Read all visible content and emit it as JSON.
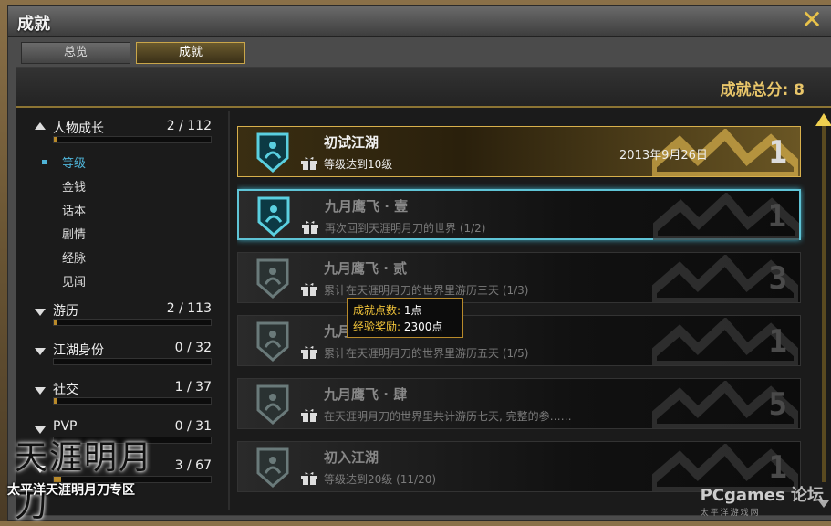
{
  "window": {
    "title": "成就",
    "close_icon": "close-icon"
  },
  "tabs": [
    {
      "label": "总览"
    },
    {
      "label": "成就",
      "active": true
    }
  ],
  "summary": {
    "label": "成就总分: 8"
  },
  "categories": [
    {
      "name": "人物成长",
      "count": "2 / 112",
      "expanded": true,
      "progress": 0.018,
      "children": [
        {
          "label": "等级",
          "active": true
        },
        {
          "label": "金钱"
        },
        {
          "label": "话本"
        },
        {
          "label": "剧情"
        },
        {
          "label": "经脉"
        },
        {
          "label": "见闻"
        }
      ]
    },
    {
      "name": "游历",
      "count": "2 / 113",
      "progress": 0.018
    },
    {
      "name": "江湖身份",
      "count": "0 / 32",
      "progress": 0
    },
    {
      "name": "社交",
      "count": "1 / 37",
      "progress": 0.027
    },
    {
      "name": "PVP",
      "count": "0 / 31",
      "progress": 0
    },
    {
      "name": "",
      "count": "3 / 67",
      "progress": 0.045
    }
  ],
  "achievements": [
    {
      "name": "初试江湖",
      "desc": "等级达到10级",
      "date": "2013年9月26日",
      "points": "1",
      "completed": true
    },
    {
      "name": "九月鹰飞 · 壹",
      "desc": "再次回到天涯明月刀的世界 (1/2)",
      "date": "",
      "points": "1",
      "highlighted": true
    },
    {
      "name": "九月鹰飞 · 贰",
      "desc": "累计在天涯明月刀的世界里游历三天 (1/3)",
      "date": "",
      "points": "3"
    },
    {
      "name": "九月鹰飞 · 叁",
      "desc": "累计在天涯明月刀的世界里游历五天 (1/5)",
      "date": "",
      "points": "1"
    },
    {
      "name": "九月鹰飞 · 肆",
      "desc": "在天涯明月刀的世界里共计游历七天, 完整的参……",
      "date": "",
      "points": "5"
    },
    {
      "name": "初入江湖",
      "desc": "等级达到20级 (11/20)",
      "date": "",
      "points": "1"
    }
  ],
  "tooltip": {
    "points_label": "成就点数:",
    "points_value": "1点",
    "exp_label": "经验奖励:",
    "exp_value": "2300点"
  },
  "watermark": {
    "left_logo": "天涯明月刀",
    "left_sub": "太平洋天涯明月刀专区",
    "right_brand": "PCgames",
    "right_sub": "太平洋游戏网",
    "right_forum": "论坛"
  },
  "colors": {
    "gold": "#d8b04c",
    "cyan": "#5fc4d6",
    "panel": "#1b1b1b"
  }
}
